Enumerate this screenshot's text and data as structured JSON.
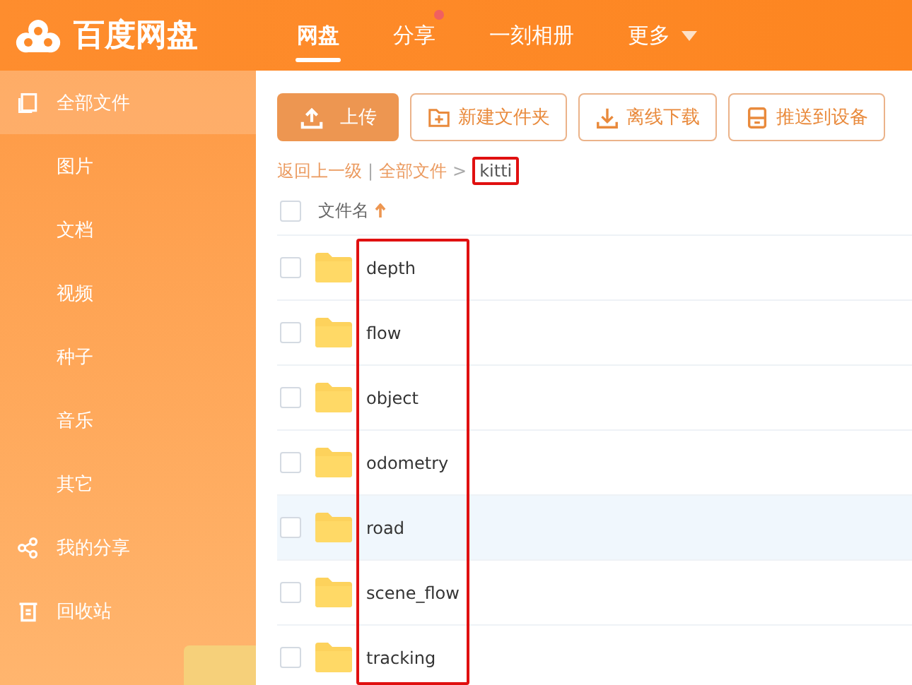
{
  "header": {
    "logo_text": "百度网盘",
    "nav": [
      {
        "label": "网盘",
        "selected": true,
        "badge": false,
        "dropdown": false
      },
      {
        "label": "分享",
        "selected": false,
        "badge": true,
        "dropdown": false
      },
      {
        "label": "一刻相册",
        "selected": false,
        "badge": false,
        "dropdown": false
      },
      {
        "label": "更多",
        "selected": false,
        "badge": false,
        "dropdown": true
      }
    ]
  },
  "sidebar": {
    "items": [
      {
        "label": "全部文件",
        "kind": "main",
        "selected": true
      },
      {
        "label": "图片",
        "kind": "sub",
        "selected": false
      },
      {
        "label": "文档",
        "kind": "sub",
        "selected": false
      },
      {
        "label": "视频",
        "kind": "sub",
        "selected": false
      },
      {
        "label": "种子",
        "kind": "sub",
        "selected": false
      },
      {
        "label": "音乐",
        "kind": "sub",
        "selected": false
      },
      {
        "label": "其它",
        "kind": "sub",
        "selected": false
      },
      {
        "label": "我的分享",
        "kind": "main",
        "selected": false
      },
      {
        "label": "回收站",
        "kind": "main",
        "selected": false
      }
    ]
  },
  "toolbar": [
    {
      "label": "上传",
      "kind": "primary"
    },
    {
      "label": "新建文件夹",
      "kind": "outline"
    },
    {
      "label": "离线下载",
      "kind": "outline"
    },
    {
      "label": "推送到设备",
      "kind": "outline"
    }
  ],
  "breadcrumb": {
    "back": "返回上一级",
    "separator": "|",
    "root": "全部文件",
    "arrow": ">",
    "current": "kitti",
    "current_outlined": true
  },
  "file_list": {
    "header": {
      "label": "文件名",
      "checked": false
    },
    "names_outlined": true,
    "rows": [
      {
        "name": "depth",
        "checked": false,
        "hovered": false
      },
      {
        "name": "flow",
        "checked": false,
        "hovered": false
      },
      {
        "name": "object",
        "checked": false,
        "hovered": false
      },
      {
        "name": "odometry",
        "checked": false,
        "hovered": false
      },
      {
        "name": "road",
        "checked": false,
        "hovered": true
      },
      {
        "name": "scene_flow",
        "checked": false,
        "hovered": false
      },
      {
        "name": "tracking",
        "checked": false,
        "hovered": false
      }
    ]
  }
}
